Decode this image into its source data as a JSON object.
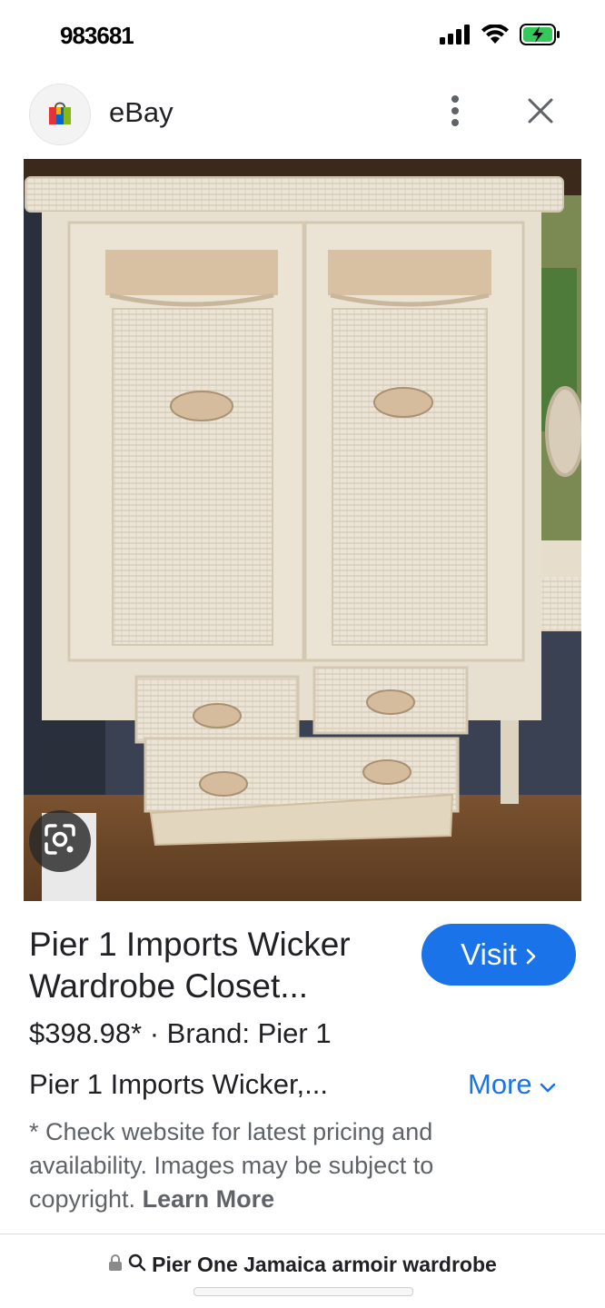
{
  "status_bar": {
    "time": "983681",
    "signal_icon": "signal-bars-icon",
    "wifi_icon": "wifi-icon",
    "battery_icon": "battery-charging-icon"
  },
  "header": {
    "site_name": "eBay",
    "logo_icon": "shopping-bag-icon",
    "menu_icon": "more-vert-icon",
    "close_icon": "close-icon"
  },
  "image": {
    "subject": "product-photo",
    "lens_icon": "google-lens-icon"
  },
  "product": {
    "title": "Pier 1 Imports Wicker Wardrobe Closet...",
    "visit_label": "Visit",
    "price_line": "$398.98* · Brand: Pier 1",
    "description": "Pier 1 Imports Wicker,...",
    "more_label": "More",
    "disclaimer": "* Check website for latest pricing and availability. Images may be subject to copyright.",
    "learn_more": "Learn More"
  },
  "url_bar": {
    "query": "Pier One Jamaica armoir wardrobe",
    "lock_icon": "lock-icon",
    "search_icon": "search-icon"
  },
  "colors": {
    "accent": "#1a73e8",
    "text": "#202124",
    "muted": "#5f6368"
  }
}
